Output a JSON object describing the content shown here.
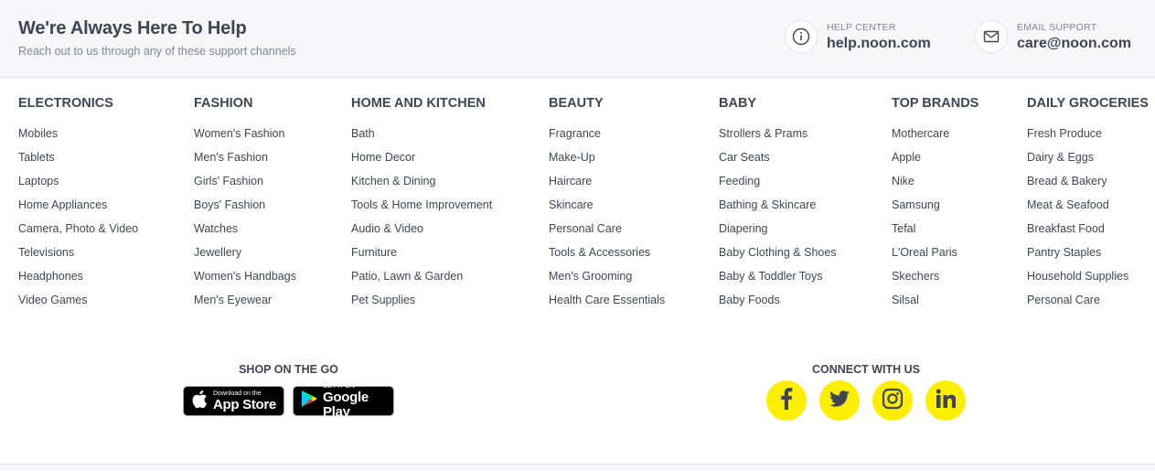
{
  "help": {
    "title": "We're Always Here To Help",
    "subtitle": "Reach out to us through any of these support channels",
    "help_center": {
      "label": "HELP CENTER",
      "value": "help.noon.com",
      "icon": "info-icon"
    },
    "email_support": {
      "label": "EMAIL SUPPORT",
      "value": "care@noon.com",
      "icon": "mail-icon"
    }
  },
  "columns": [
    {
      "heading": "ELECTRONICS",
      "items": [
        "Mobiles",
        "Tablets",
        "Laptops",
        "Home Appliances",
        "Camera, Photo & Video",
        "Televisions",
        "Headphones",
        "Video Games"
      ]
    },
    {
      "heading": "FASHION",
      "items": [
        "Women's Fashion",
        "Men's Fashion",
        "Girls' Fashion",
        "Boys' Fashion",
        "Watches",
        "Jewellery",
        "Women's Handbags",
        "Men's Eyewear"
      ]
    },
    {
      "heading": "HOME AND KITCHEN",
      "items": [
        "Bath",
        "Home Decor",
        "Kitchen & Dining",
        "Tools & Home Improvement",
        "Audio & Video",
        "Furniture",
        "Patio, Lawn & Garden",
        "Pet Supplies"
      ]
    },
    {
      "heading": "BEAUTY",
      "items": [
        "Fragrance",
        "Make-Up",
        "Haircare",
        "Skincare",
        "Personal Care",
        "Tools & Accessories",
        "Men's Grooming",
        "Health Care Essentials"
      ]
    },
    {
      "heading": "BABY",
      "items": [
        "Strollers & Prams",
        "Car Seats",
        "Feeding",
        "Bathing & Skincare",
        "Diapering",
        "Baby Clothing & Shoes",
        "Baby & Toddler Toys",
        "Baby Foods"
      ]
    },
    {
      "heading": "TOP BRANDS",
      "items": [
        "Mothercare",
        "Apple",
        "Nike",
        "Samsung",
        "Tefal",
        "L'Oreal Paris",
        "Skechers",
        "Silsal"
      ]
    },
    {
      "heading": "DAILY GROCERIES",
      "items": [
        "Fresh Produce",
        "Dairy & Eggs",
        "Bread & Bakery",
        "Meat & Seafood",
        "Breakfast Food",
        "Pantry Staples",
        "Household Supplies",
        "Personal Care"
      ]
    }
  ],
  "shop": {
    "title": "SHOP ON THE GO",
    "app_store": {
      "small": "Download on the",
      "big": "App Store",
      "icon": "apple-icon"
    },
    "google_play": {
      "small": "GET IT ON",
      "big": "Google Play",
      "icon": "google-play-icon"
    }
  },
  "connect": {
    "title": "CONNECT WITH US",
    "networks": [
      "facebook-icon",
      "twitter-icon",
      "instagram-icon",
      "linkedin-icon"
    ],
    "accent_color": "#feee00"
  },
  "colors": {
    "text": "#404553",
    "muted": "#7e859b",
    "bar_bg": "#f7f7fa"
  }
}
